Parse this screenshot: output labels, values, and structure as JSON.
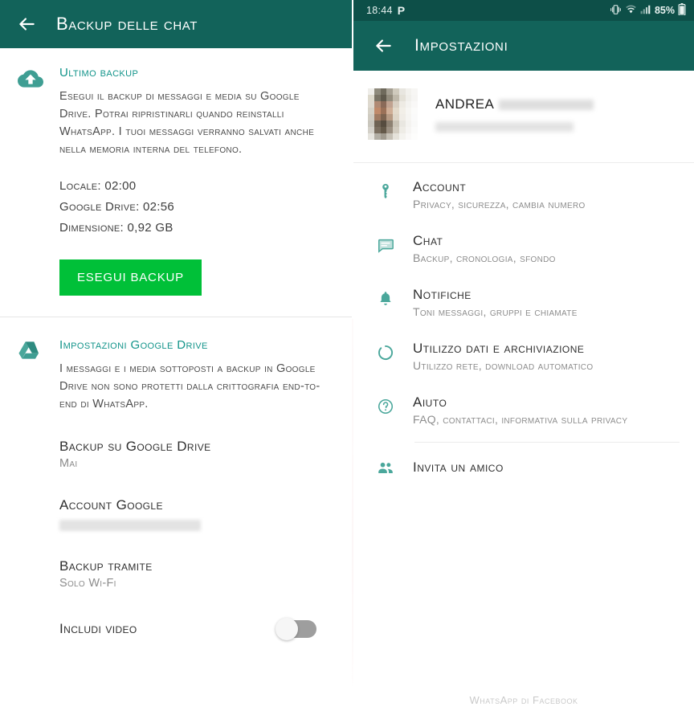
{
  "colors": {
    "header_teal": "#12635a",
    "statusbar_teal": "#0d4f48",
    "accent_teal": "#12948a",
    "icon_teal": "#4aa79b",
    "button_green": "#00c038",
    "text_dark": "#2f2f2f",
    "text_muted": "#8b8b8b"
  },
  "left_panel": {
    "header": {
      "title": "Backup delle chat",
      "back_icon": "arrow-left-icon"
    },
    "last_backup": {
      "icon": "cloud-upload-icon",
      "heading": "Ultimo backup",
      "description": "Esegui il backup di messaggi e media su Google Drive. Potrai ripristinarli quando reinstalli WhatsApp. I tuoi messaggi verranno salvati anche nella memoria interna del telefono.",
      "stats": [
        {
          "label": "Locale:",
          "value": "02:00"
        },
        {
          "label": "Google Drive:",
          "value": "02:56"
        },
        {
          "label": "Dimensione:",
          "value": "0,92 GB"
        }
      ],
      "button_label": "ESEGUI BACKUP"
    },
    "drive_settings": {
      "icon": "google-drive-icon",
      "heading": "Impostazioni Google Drive",
      "description": "I messaggi e i media sottoposti a backup in Google Drive non sono protetti dalla crittografia end-to-end di WhatsApp.",
      "options": [
        {
          "title": "Backup su Google Drive",
          "value": "Mai",
          "redacted": false
        },
        {
          "title": "Account Google",
          "value": "",
          "redacted": true
        },
        {
          "title": "Backup tramite",
          "value": "Solo Wi-Fi",
          "redacted": false
        }
      ],
      "include_videos": {
        "label": "Includi video",
        "toggle_state": "off"
      }
    }
  },
  "right_panel": {
    "statusbar": {
      "time": "18:44",
      "left_icons": [
        "parking-p-icon"
      ],
      "right_icons": [
        "vibrate-icon",
        "wifi-icon",
        "signal-bars-icon",
        "battery-icon"
      ],
      "battery_percent": "85%"
    },
    "header": {
      "title": "Impostazioni",
      "back_icon": "arrow-left-icon"
    },
    "profile": {
      "avatar": "pixelated-avatar",
      "name": "ANDREA",
      "name_redacted": true,
      "status_redacted": true
    },
    "items": [
      {
        "icon": "key-icon",
        "title": "Account",
        "subtitle": "Privacy, sicurezza, cambia numero"
      },
      {
        "icon": "chat-bubble-icon",
        "title": "Chat",
        "subtitle": "Backup, cronologia, sfondo"
      },
      {
        "icon": "bell-icon",
        "title": "Notifiche",
        "subtitle": "Toni messaggi, gruppi e chiamate"
      },
      {
        "icon": "data-usage-icon",
        "title": "Utilizzo dati e archiviazione",
        "subtitle": "Utilizzo rete, download automatico"
      },
      {
        "icon": "help-circle-icon",
        "title": "Aiuto",
        "subtitle": "FAQ, contattaci, informativa sulla privacy"
      }
    ],
    "invite": {
      "icon": "people-icon",
      "title": "Invita un amico",
      "subtitle": ""
    },
    "footer": "WhatsApp di Facebook"
  }
}
